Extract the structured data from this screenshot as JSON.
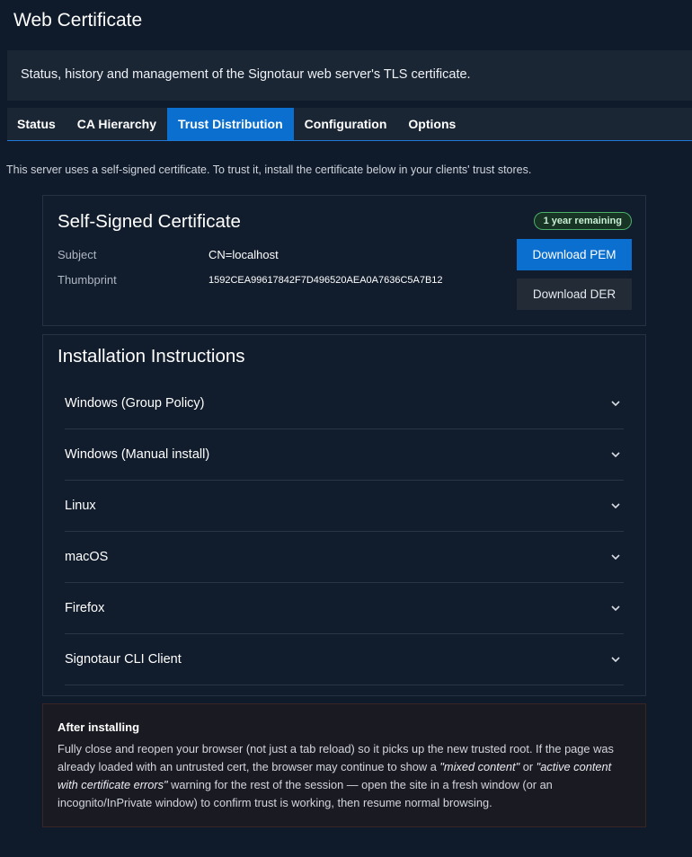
{
  "page": {
    "title": "Web Certificate",
    "subtitle": "Status, history and management of the Signotaur web server's TLS certificate."
  },
  "tabs": [
    {
      "label": "Status"
    },
    {
      "label": "CA Hierarchy"
    },
    {
      "label": "Trust Distribution",
      "active": true
    },
    {
      "label": "Configuration"
    },
    {
      "label": "Options"
    }
  ],
  "intro": "This server uses a self-signed certificate. To trust it, install the certificate below in your clients' trust stores.",
  "certificate": {
    "title": "Self-Signed Certificate",
    "badge": "1 year remaining",
    "subject_label": "Subject",
    "subject_value": "CN=localhost",
    "thumbprint_label": "Thumbprint",
    "thumbprint_value": "1592CEA99617842F7D496520AEA0A7636C5A7B12",
    "download_pem": "Download PEM",
    "download_der": "Download DER"
  },
  "instructions": {
    "title": "Installation Instructions",
    "items": [
      {
        "label": "Windows (Group Policy)"
      },
      {
        "label": "Windows (Manual install)"
      },
      {
        "label": "Linux"
      },
      {
        "label": "macOS"
      },
      {
        "label": "Firefox"
      },
      {
        "label": "Signotaur CLI Client"
      }
    ]
  },
  "after_install": {
    "title": "After installing",
    "text_1": "Fully close and reopen your browser (not just a tab reload) so it picks up the new trusted root. If the page was already loaded with an untrusted cert, the browser may continue to show a ",
    "em_1": "\"mixed content\"",
    "text_2": " or ",
    "em_2": "\"active content with certificate errors\"",
    "text_3": " warning for the rest of the session — open the site in a fresh window (or an incognito/InPrivate window) to confirm trust is working, then resume normal browsing."
  },
  "colors": {
    "accent": "#0b6fd0",
    "background": "#0f1a2a",
    "badge_green": "#4caf6a"
  }
}
